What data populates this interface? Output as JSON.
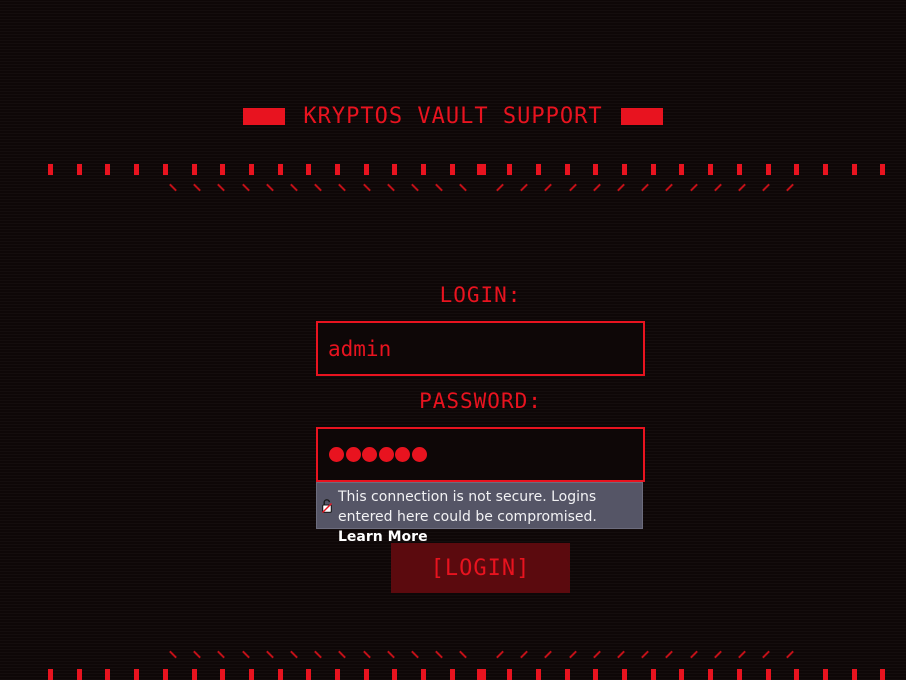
{
  "header": {
    "title": "KRYPTOS VAULT SUPPORT"
  },
  "login_form": {
    "login_label": "LOGIN:",
    "login_value": "admin",
    "password_label": "PASSWORD:",
    "password_length": 6,
    "submit_label": "[LOGIN]"
  },
  "security_warning": {
    "icon": "insecure-lock-icon",
    "message": "This connection is not secure. Logins entered here could be compromised.",
    "link_label": "Learn More"
  },
  "theme": {
    "background": "#0e0707",
    "accent": "#e8131f",
    "button_background": "#5b0a0e",
    "warning_background": "#555566"
  }
}
